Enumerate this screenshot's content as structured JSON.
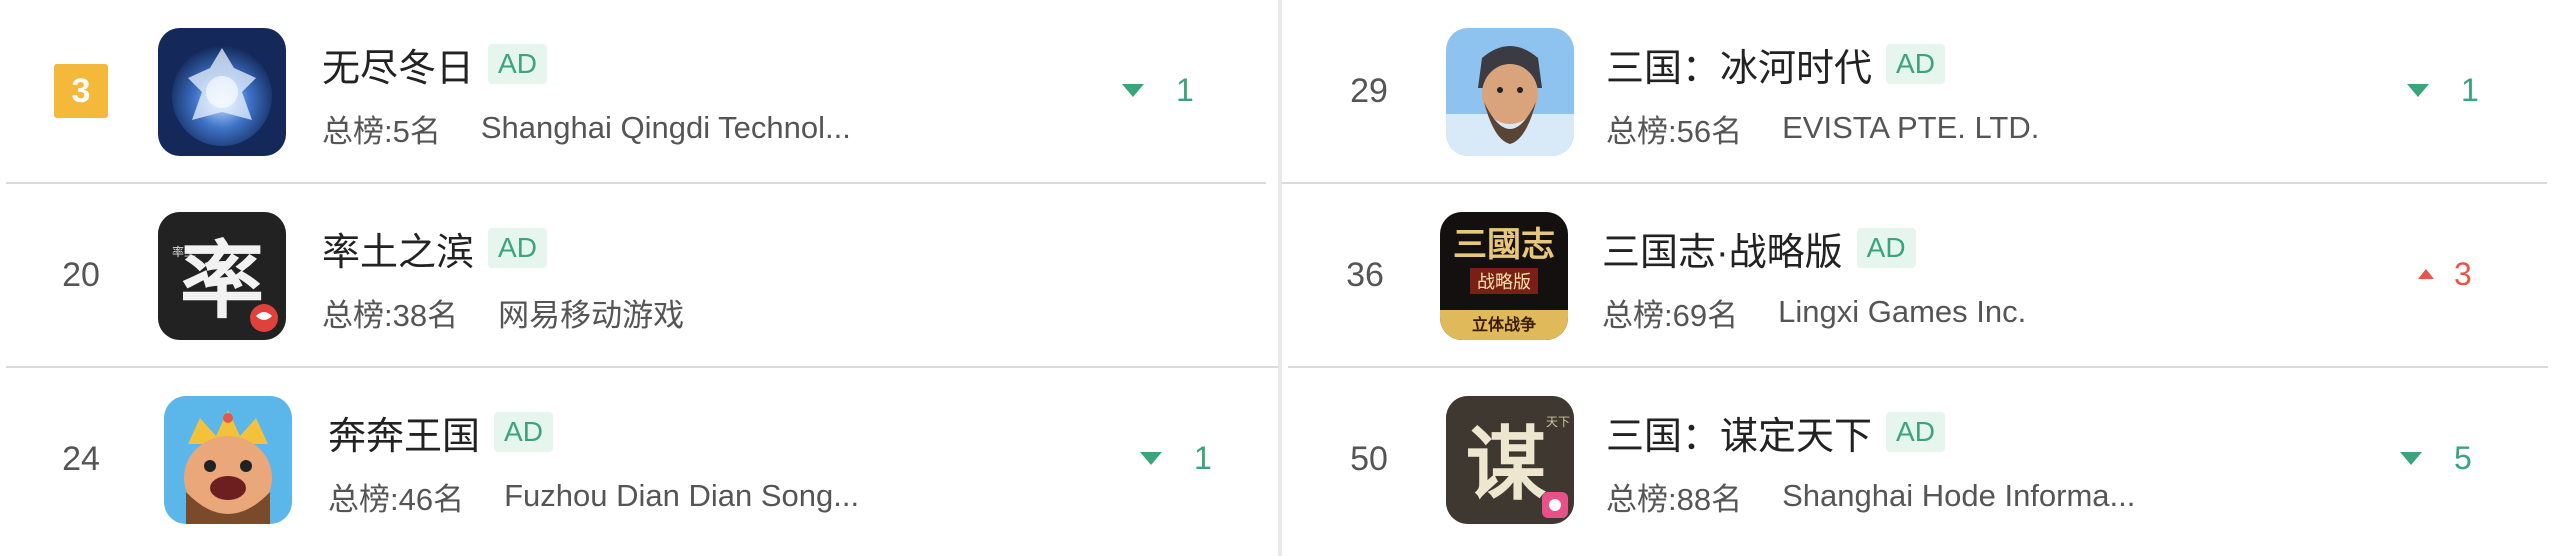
{
  "left_column": [
    {
      "rank": "3",
      "name": "无尽冬日",
      "ad": "AD",
      "overall": "总榜:5名",
      "publisher": "Shanghai Qingdi Technol...",
      "trend_dir": "down",
      "trend_val": "1",
      "icon": "frost-orb-icon"
    },
    {
      "rank": "20",
      "name": "率土之滨",
      "ad": "AD",
      "overall": "总榜:38名",
      "publisher": "网易移动游戏",
      "trend_dir": "none",
      "trend_val": "",
      "icon": "calligraphy-lv-icon"
    },
    {
      "rank": "24",
      "name": "奔奔王国",
      "ad": "AD",
      "overall": "总榜:46名",
      "publisher": "Fuzhou Dian Dian Song...",
      "trend_dir": "down",
      "trend_val": "1",
      "icon": "king-character-icon"
    }
  ],
  "right_column": [
    {
      "rank": "29",
      "name": "三国：冰河时代",
      "ad": "AD",
      "overall": "总榜:56名",
      "publisher": "EVISTA PTE. LTD.",
      "trend_dir": "down",
      "trend_val": "1",
      "icon": "bearded-warrior-icon"
    },
    {
      "rank": "36",
      "name": "三国志·战略版",
      "ad": "AD",
      "overall": "总榜:69名",
      "publisher": "Lingxi Games Inc.",
      "trend_dir": "up",
      "trend_val": "3",
      "icon": "sanguozhi-logo-icon"
    },
    {
      "rank": "50",
      "name": "三国：谋定天下",
      "ad": "AD",
      "overall": "总榜:88名",
      "publisher": "Shanghai Hode Informa...",
      "trend_dir": "down",
      "trend_val": "5",
      "icon": "calligraphy-mou-icon"
    }
  ],
  "colors": {
    "rank_highlight": "#f4b93a",
    "ad_text": "#3aa57c",
    "ad_bg": "#e6f5ee",
    "trend_down": "#3aa57c",
    "trend_up": "#e8564a"
  },
  "icon_text": {
    "sanguozhi_line1": "三國志",
    "sanguozhi_line2": "战略版",
    "sanguozhi_tag": "立体战争",
    "lvtu_small": "率土",
    "lvtu_big": "率",
    "mou_big": "谋",
    "mou_small": "天下"
  }
}
